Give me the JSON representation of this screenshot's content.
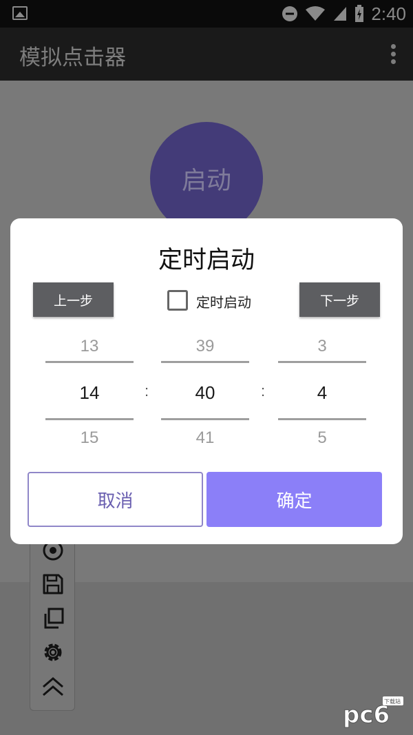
{
  "status_bar": {
    "time": "2:40"
  },
  "app_bar": {
    "title": "模拟点击器"
  },
  "main": {
    "start_button_label": "启动"
  },
  "dialog": {
    "title": "定时启动",
    "prev_step_label": "上一步",
    "next_step_label": "下一步",
    "timer_checkbox_label": "定时启动",
    "timer_checkbox_checked": false,
    "hour": {
      "prev": "13",
      "current": "14",
      "next": "15"
    },
    "minute": {
      "prev": "39",
      "current": "40",
      "next": "41"
    },
    "second": {
      "prev": "3",
      "current": "4",
      "next": "5"
    },
    "separator": ":",
    "cancel_label": "取消",
    "confirm_label": "确定"
  },
  "toolbar_icons": [
    "record-icon",
    "save-icon",
    "copy-icon",
    "settings-icon",
    "collapse-up-icon"
  ],
  "colors": {
    "accent": "#8b7ff8",
    "start_button": "#433b78"
  }
}
